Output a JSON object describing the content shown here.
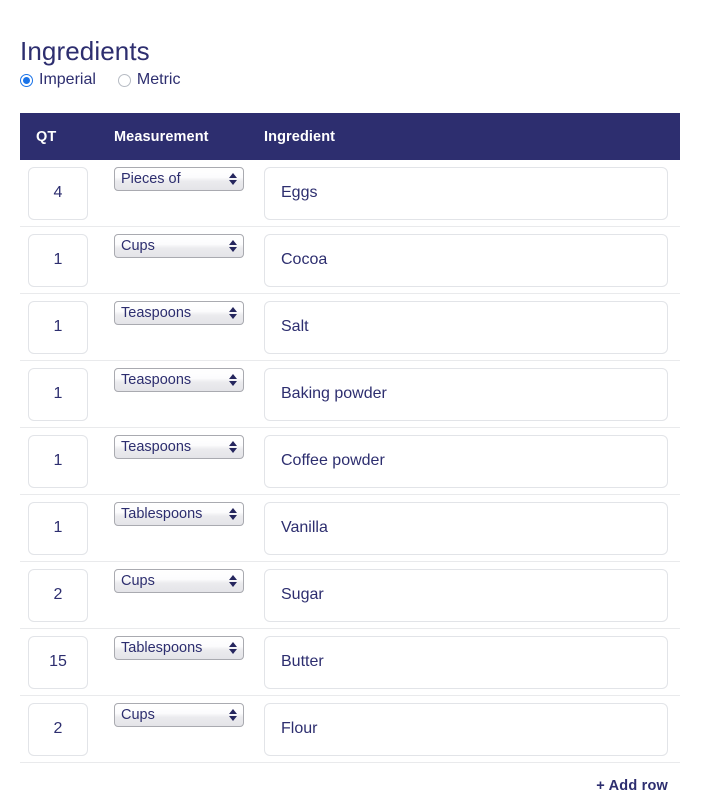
{
  "page": {
    "title": "Ingredients"
  },
  "unit_system": {
    "selected": "Imperial",
    "options": [
      {
        "label": "Imperial",
        "checked": true
      },
      {
        "label": "Metric",
        "checked": false
      }
    ]
  },
  "table": {
    "columns": [
      {
        "key": "qt",
        "label": "QT"
      },
      {
        "key": "measurement",
        "label": "Measurement"
      },
      {
        "key": "ingredient",
        "label": "Ingredient"
      }
    ],
    "measurement_options": [
      "Pieces of",
      "Cups",
      "Teaspoons",
      "Tablespoons"
    ],
    "rows": [
      {
        "qt": "4",
        "measurement": "Pieces of",
        "ingredient": "Eggs"
      },
      {
        "qt": "1",
        "measurement": "Cups",
        "ingredient": "Cocoa"
      },
      {
        "qt": "1",
        "measurement": "Teaspoons",
        "ingredient": "Salt"
      },
      {
        "qt": "1",
        "measurement": "Teaspoons",
        "ingredient": "Baking powder"
      },
      {
        "qt": "1",
        "measurement": "Teaspoons",
        "ingredient": "Coffee powder"
      },
      {
        "qt": "1",
        "measurement": "Tablespoons",
        "ingredient": "Vanilla"
      },
      {
        "qt": "2",
        "measurement": "Cups",
        "ingredient": "Sugar"
      },
      {
        "qt": "15",
        "measurement": "Tablespoons",
        "ingredient": "Butter"
      },
      {
        "qt": "2",
        "measurement": "Cups",
        "ingredient": "Flour"
      }
    ]
  },
  "footer": {
    "add_row_label": "+ Add row"
  },
  "colors": {
    "header_navy": "#2d2e6f",
    "text_navy": "#2d2e6f",
    "radio_accent": "#1a73e8",
    "border_light": "#e2e4e8",
    "row_divider": "#e9eaec"
  }
}
